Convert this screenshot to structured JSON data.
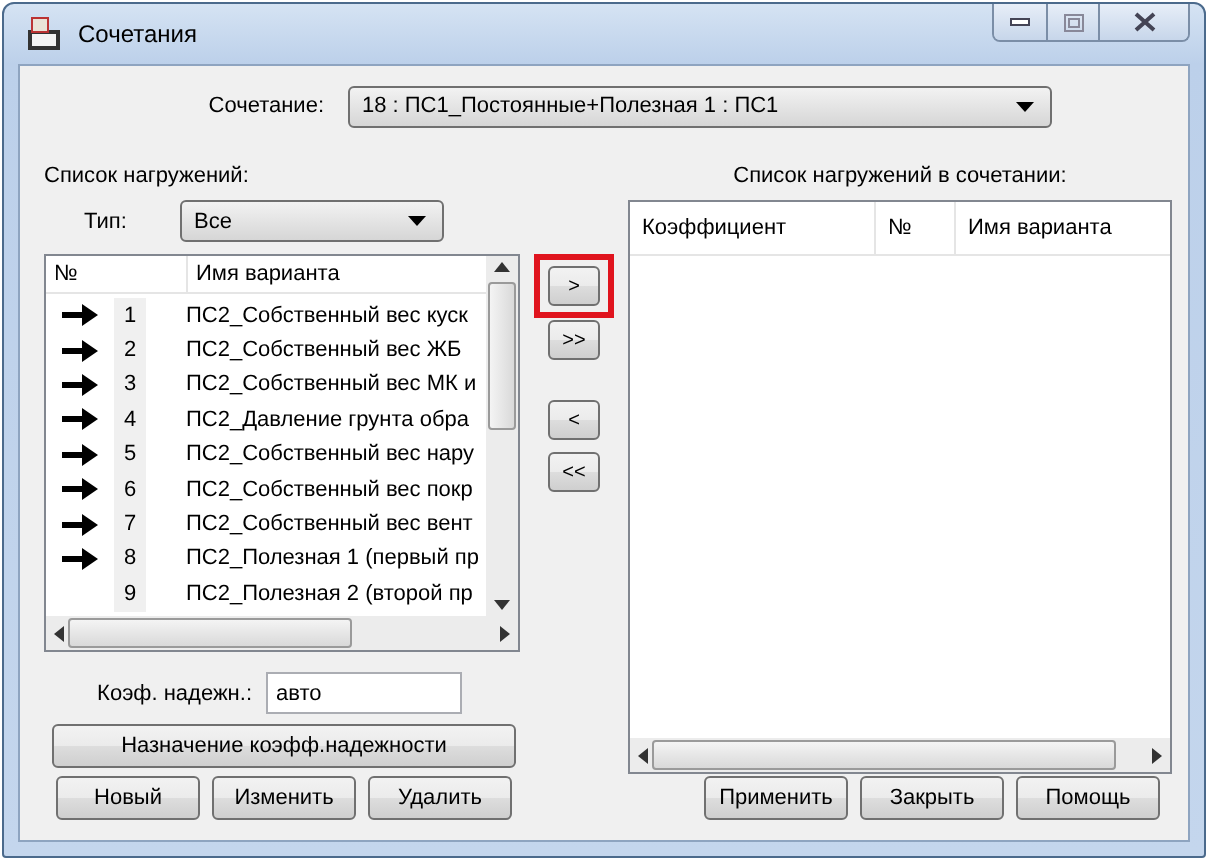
{
  "window": {
    "title": "Сочетания"
  },
  "combination": {
    "label": "Сочетание:",
    "value": "18 : ПС1_Постоянные+Полезная 1 : ПС1"
  },
  "load_list": {
    "title": "Список нагружений:",
    "type_label": "Тип:",
    "type_value": "Все",
    "columns": [
      "№",
      "Имя варианта"
    ],
    "rows": [
      {
        "included": true,
        "number": "1",
        "name": "ПС2_Собственный вес куск"
      },
      {
        "included": true,
        "number": "2",
        "name": "ПС2_Собственный вес ЖБ"
      },
      {
        "included": true,
        "number": "3",
        "name": "ПС2_Собственный вес МК и"
      },
      {
        "included": true,
        "number": "4",
        "name": "ПС2_Давление грунта обра"
      },
      {
        "included": true,
        "number": "5",
        "name": "ПС2_Собственный вес нару"
      },
      {
        "included": true,
        "number": "6",
        "name": "ПС2_Собственный вес покр"
      },
      {
        "included": true,
        "number": "7",
        "name": "ПС2_Собственный вес вент"
      },
      {
        "included": true,
        "number": "8",
        "name": "ПС2_Полезная 1 (первый пр"
      },
      {
        "included": false,
        "number": "9",
        "name": "ПС2_Полезная 2 (второй пр"
      }
    ]
  },
  "move_buttons": [
    {
      "label": ">",
      "highlighted": true
    },
    {
      "label": ">>",
      "highlighted": false
    },
    {
      "label": "<",
      "highlighted": false
    },
    {
      "label": "<<",
      "highlighted": false
    }
  ],
  "combo_list": {
    "title": "Список нагружений в сочетании:",
    "columns": [
      "Коэффициент",
      "№",
      "Имя варианта"
    ]
  },
  "reliability": {
    "label": "Коэф. надежн.:",
    "value": "авто",
    "button": "Назначение коэфф.надежности"
  },
  "buttons_left": [
    "Новый",
    "Изменить",
    "Удалить"
  ],
  "buttons_right": [
    "Применить",
    "Закрыть",
    "Помощь"
  ]
}
